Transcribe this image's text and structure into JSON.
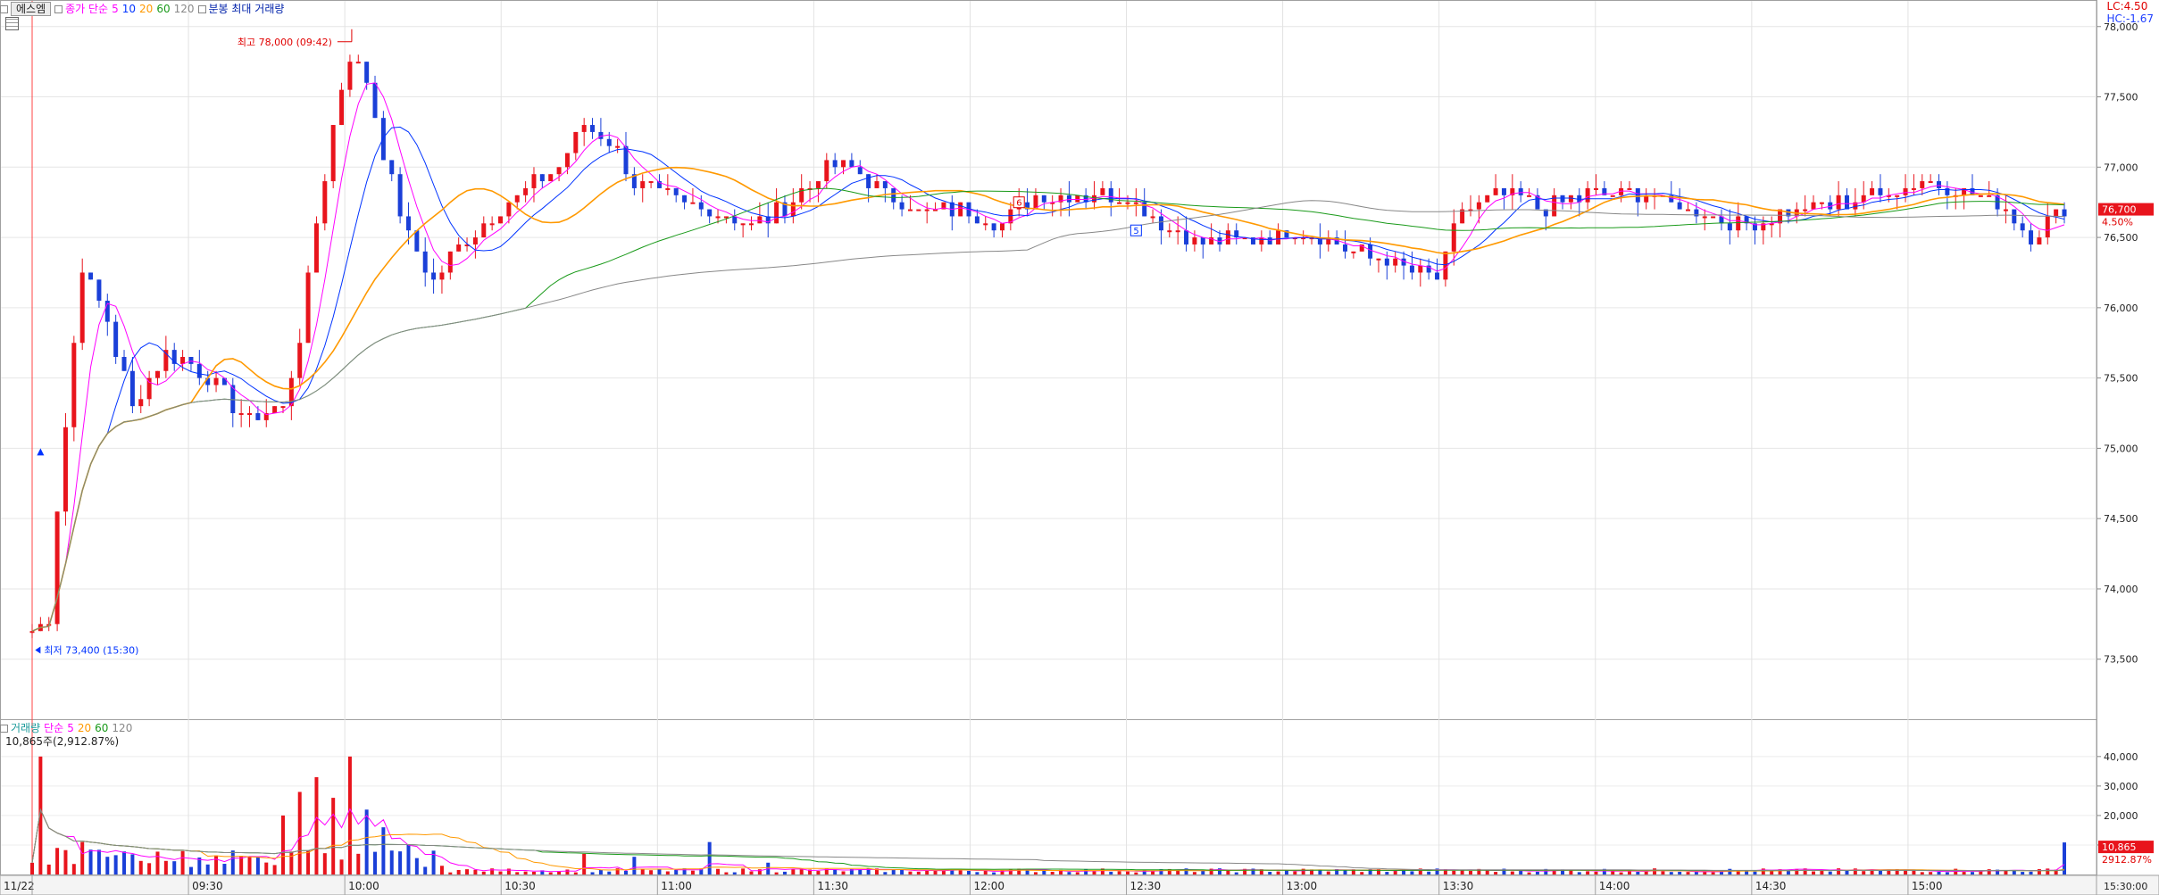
{
  "header": {
    "tab_label": "에스엠",
    "price_label": "종가 단순",
    "ma_periods": [
      "5",
      "10",
      "20",
      "60",
      "120"
    ],
    "ma_colors": [
      "#ff00ff",
      "#0033ff",
      "#ff9900",
      "#1a9a1a",
      "#888888"
    ],
    "volume_label": "분봉 최대 거래량",
    "lc_text": "LC:4.50",
    "hc_text": "HC:-1.67"
  },
  "volume_header": {
    "label": "거래량",
    "ma_label": "단순",
    "ma_periods": [
      "5",
      "20",
      "60",
      "120"
    ],
    "info": "10,865주(2,912.87%)"
  },
  "chart_data": [
    {
      "type": "candlestick",
      "y_ticks": [
        "78,000",
        "77,500",
        "77,000",
        "76,500",
        "76,000",
        "75,500",
        "75,000",
        "74,500",
        "74,000",
        "73,500"
      ],
      "ylim": [
        73200,
        78100
      ],
      "x_ticks": [
        "11/22",
        "09:30",
        "10:00",
        "10:30",
        "11:00",
        "11:30",
        "12:00",
        "12:30",
        "13:00",
        "13:30",
        "14:00",
        "14:30",
        "15:00"
      ],
      "annotations": {
        "high": "최고 78,000 (09:42)",
        "low": "최저 73,400 (15:30)",
        "marker_6": "6",
        "marker_5": "5"
      },
      "current_price": "76,700",
      "current_change": "4.50%",
      "up_color": "#e8141c",
      "down_color": "#1a3fd8",
      "price_points": [
        [
          0,
          73700
        ],
        [
          2,
          73800
        ],
        [
          3,
          74600
        ],
        [
          6,
          76300
        ],
        [
          9,
          75900
        ],
        [
          12,
          75300
        ],
        [
          16,
          75700
        ],
        [
          21,
          75500
        ],
        [
          26,
          75200
        ],
        [
          30,
          75300
        ],
        [
          32,
          75800
        ],
        [
          34,
          76600
        ],
        [
          36,
          77300
        ],
        [
          38,
          77800
        ],
        [
          40,
          77600
        ],
        [
          42,
          77100
        ],
        [
          45,
          76500
        ],
        [
          48,
          76200
        ],
        [
          52,
          76500
        ],
        [
          56,
          76700
        ],
        [
          60,
          76900
        ],
        [
          63,
          77000
        ],
        [
          66,
          77300
        ],
        [
          69,
          77200
        ],
        [
          72,
          76900
        ],
        [
          75,
          76800
        ],
        [
          80,
          76700
        ],
        [
          86,
          76600
        ],
        [
          90,
          76700
        ],
        [
          95,
          77000
        ],
        [
          98,
          77000
        ],
        [
          102,
          76800
        ],
        [
          106,
          76700
        ],
        [
          111,
          76700
        ],
        [
          116,
          76600
        ],
        [
          120,
          76800
        ],
        [
          126,
          76800
        ],
        [
          131,
          76800
        ],
        [
          135,
          76600
        ],
        [
          140,
          76450
        ],
        [
          146,
          76500
        ],
        [
          152,
          76550
        ],
        [
          158,
          76400
        ],
        [
          164,
          76300
        ],
        [
          168,
          76200
        ],
        [
          171,
          76700
        ],
        [
          176,
          76800
        ],
        [
          181,
          76700
        ],
        [
          186,
          76800
        ],
        [
          193,
          76800
        ],
        [
          198,
          76700
        ],
        [
          205,
          76600
        ],
        [
          212,
          76700
        ],
        [
          220,
          76800
        ],
        [
          226,
          76900
        ],
        [
          232,
          76800
        ],
        [
          236,
          76700
        ],
        [
          239,
          76500
        ],
        [
          241,
          76600
        ],
        [
          243,
          76700
        ]
      ],
      "volume_peaks": [
        [
          1,
          40000
        ],
        [
          3,
          9000
        ],
        [
          6,
          11000
        ],
        [
          9,
          6000
        ],
        [
          30,
          20000
        ],
        [
          32,
          28000
        ],
        [
          34,
          33000
        ],
        [
          36,
          26000
        ],
        [
          38,
          40000
        ],
        [
          40,
          22000
        ],
        [
          42,
          16000
        ],
        [
          45,
          10000
        ],
        [
          66,
          7000
        ],
        [
          72,
          6000
        ],
        [
          81,
          11000
        ],
        [
          88,
          4000
        ],
        [
          166,
          2000
        ],
        [
          243,
          10865
        ]
      ],
      "volume_y_ticks": [
        "40,000",
        "30,000",
        "20,000",
        "10,000"
      ],
      "volume_ylim": [
        0,
        46000
      ],
      "volume_current": "10,865",
      "volume_current_pct": "2912.87%",
      "time_end": "15:30:00"
    }
  ]
}
